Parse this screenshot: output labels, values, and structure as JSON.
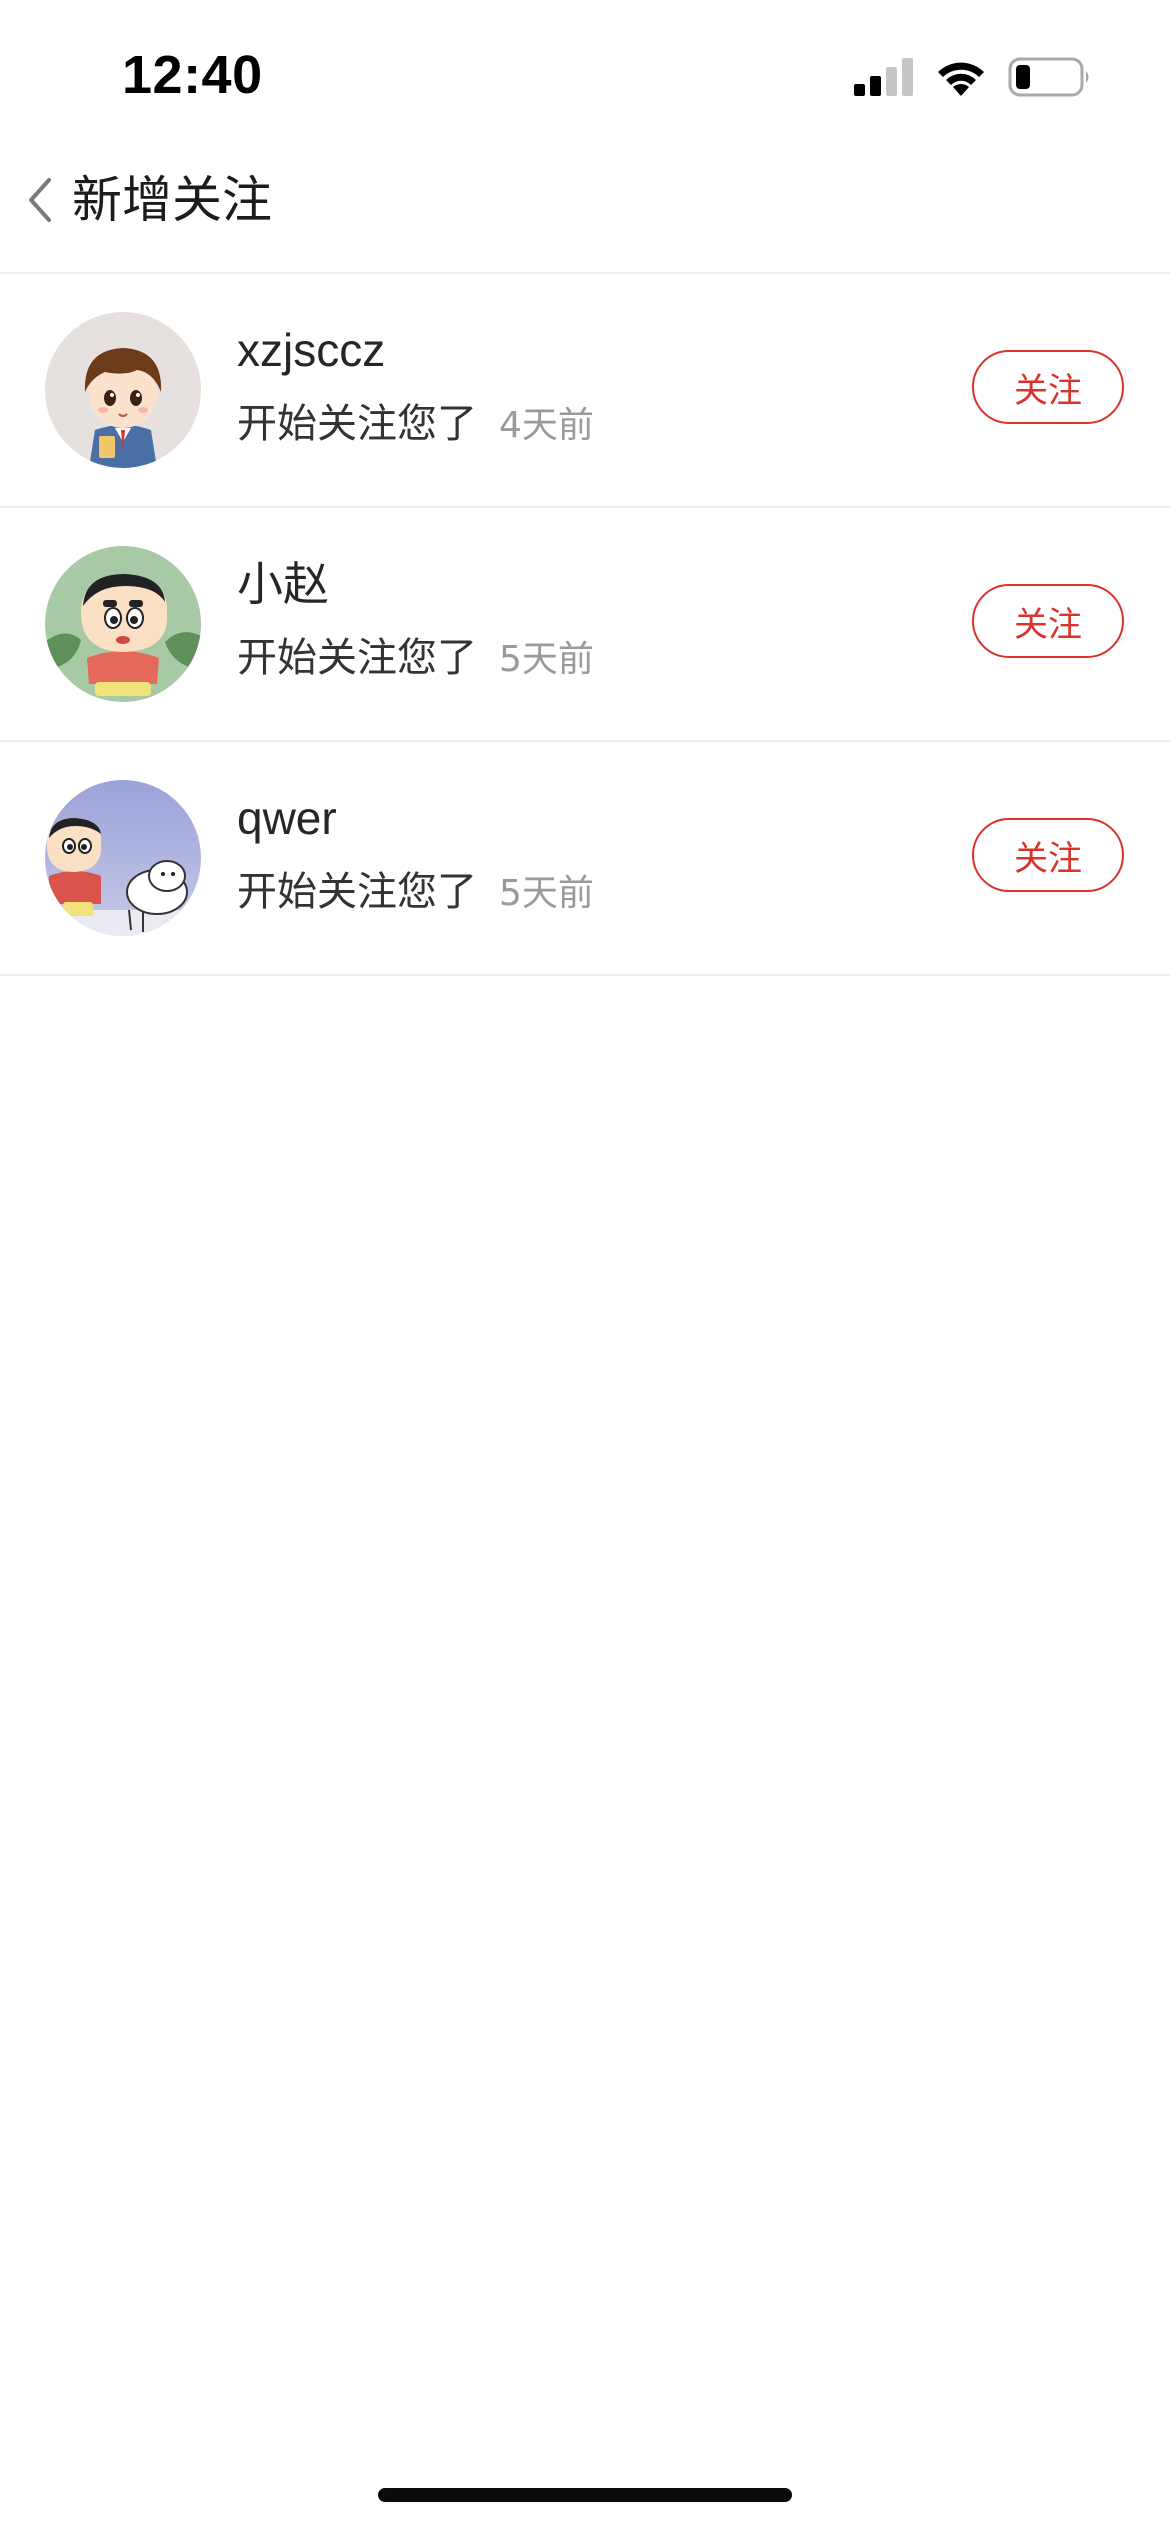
{
  "status_bar": {
    "time": "12:40",
    "icons": [
      "signal-icon",
      "wifi-icon",
      "battery-icon"
    ],
    "signal_bars": 2,
    "battery_level": 0.2
  },
  "header": {
    "title": "新增关注",
    "back_icon": "chevron-left-icon"
  },
  "colors": {
    "accent": "#d9342b",
    "divider": "#ececec",
    "secondary_text": "#9a9a9a"
  },
  "followers": [
    {
      "name": "xzjsccz",
      "message": "开始关注您了",
      "time": "4天前",
      "button_label": "关注",
      "avatar_icon": "cartoon-boy-avatar"
    },
    {
      "name": "小赵",
      "message": "开始关注您了",
      "time": "5天前",
      "button_label": "关注",
      "avatar_icon": "crayon-shin-chan-avatar"
    },
    {
      "name": "qwer",
      "message": "开始关注您了",
      "time": "5天前",
      "button_label": "关注",
      "avatar_icon": "shin-chan-with-dog-avatar"
    }
  ]
}
